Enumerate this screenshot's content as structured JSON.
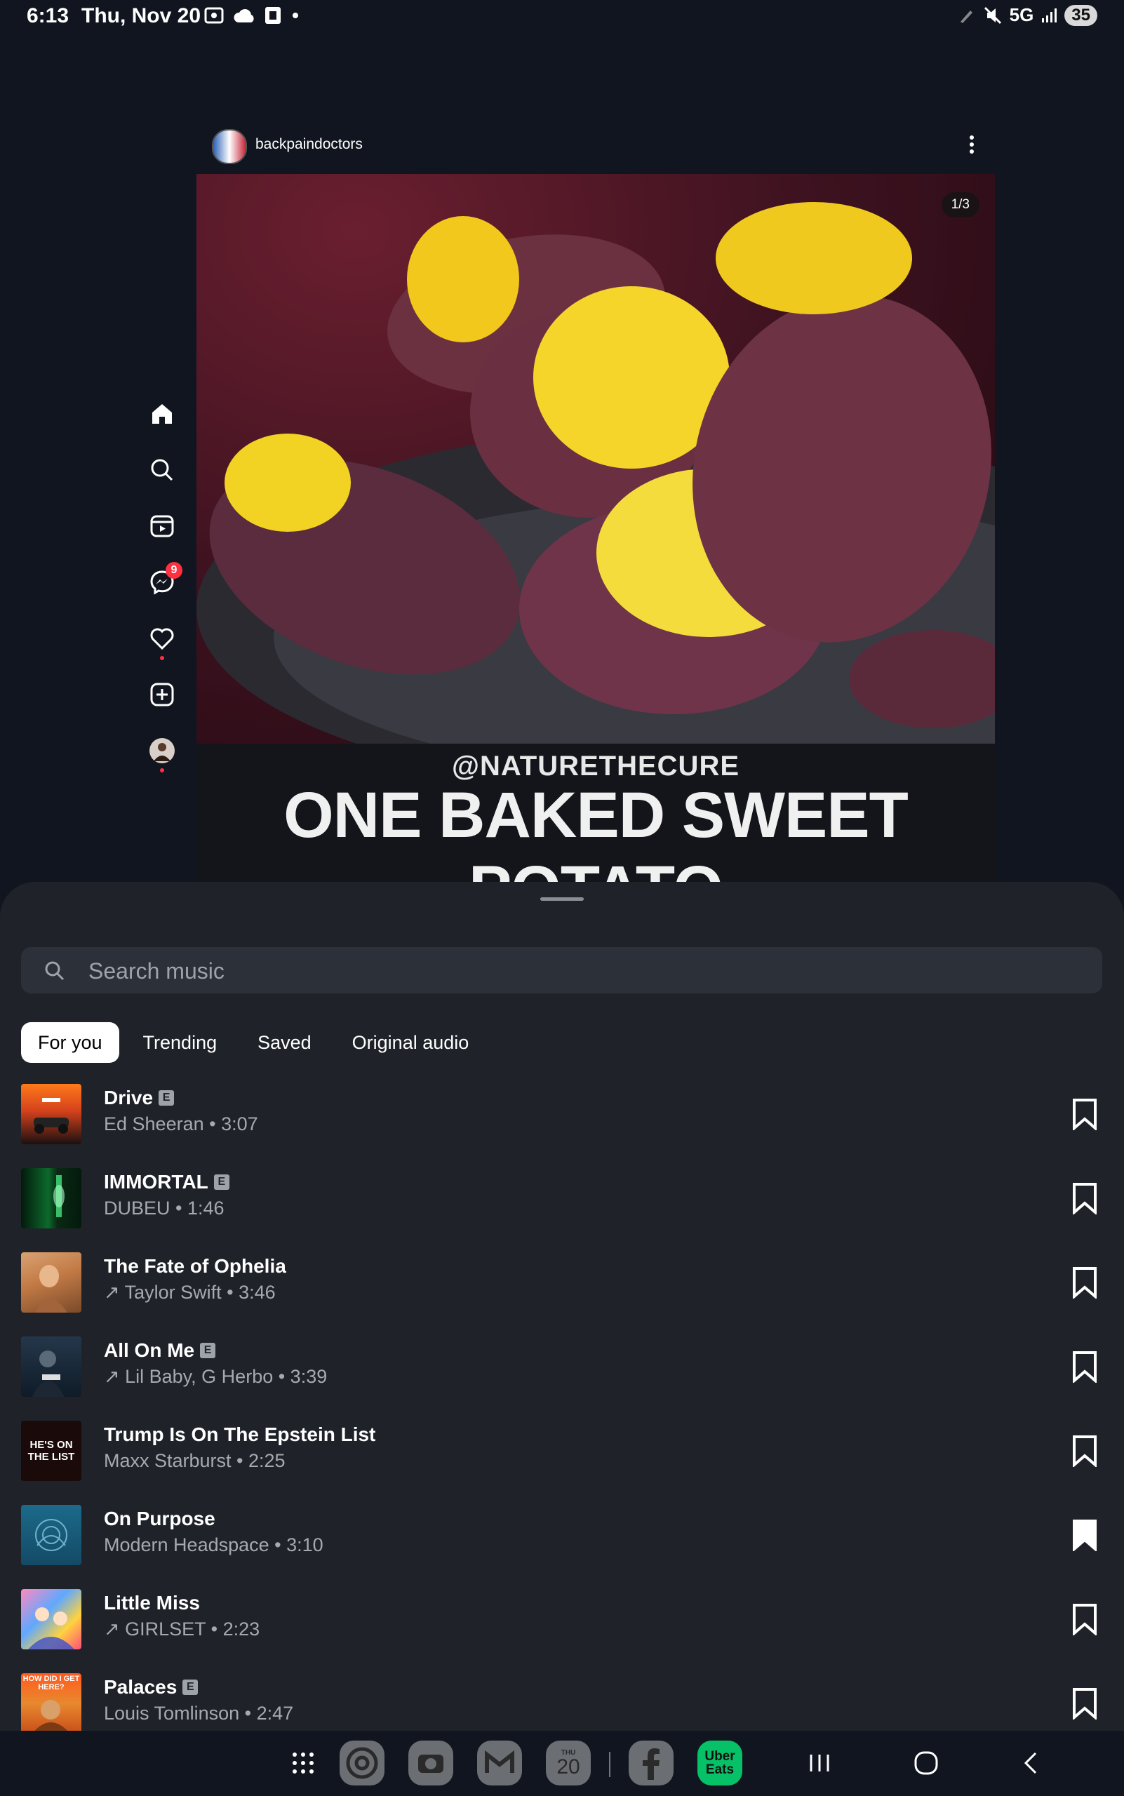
{
  "status_bar": {
    "time": "6:13",
    "date": "Thu, Nov 20",
    "network": "5G",
    "battery": "35"
  },
  "side_nav": {
    "items": [
      "home-icon",
      "search-icon",
      "reels-icon",
      "messenger-icon",
      "heart-icon",
      "create-icon",
      "profile-avatar"
    ],
    "messenger_badge": "9"
  },
  "post": {
    "username": "backpaindoctors",
    "counter": "1/3",
    "caption_handle": "@NATURETHECURE",
    "caption_title": "ONE BAKED SWEET POTATO"
  },
  "music_sheet": {
    "search_placeholder": "Search music",
    "tabs": [
      "For you",
      "Trending",
      "Saved",
      "Original audio"
    ],
    "active_tab": "For you",
    "tracks": [
      {
        "title": "Drive",
        "explicit": true,
        "meta": "Ed Sheeran • 3:07",
        "saved": false
      },
      {
        "title": "IMMORTAL",
        "explicit": true,
        "meta": "DUBEU • 1:46",
        "saved": false
      },
      {
        "title": "The Fate of Ophelia",
        "explicit": false,
        "meta": "↗ Taylor Swift • 3:46",
        "saved": false
      },
      {
        "title": "All On Me",
        "explicit": true,
        "meta": "↗ Lil Baby, G Herbo • 3:39",
        "saved": false
      },
      {
        "title": "Trump Is On The Epstein List",
        "explicit": false,
        "meta": "Maxx Starburst • 2:25",
        "saved": false
      },
      {
        "title": "On Purpose",
        "explicit": false,
        "meta": "Modern Headspace • 3:10",
        "saved": true
      },
      {
        "title": "Little Miss",
        "explicit": false,
        "meta": "↗ GIRLSET • 2:23",
        "saved": false
      },
      {
        "title": "Palaces",
        "explicit": true,
        "meta": "Louis Tomlinson • 2:47",
        "saved": false
      }
    ],
    "explicit_label": "E",
    "thumb_texts": {
      "epstein": "HE'S ON THE LIST",
      "palaces": "HOW DID I GET HERE?"
    }
  },
  "nav_bar": {
    "calendar_day": "20",
    "calendar_dow": "THU",
    "uber_eats": "Uber Eats"
  },
  "colors": {
    "background": "#10151f",
    "sheet": "#1f2329",
    "badge": "#ff3040",
    "uber_green": "#06c167"
  }
}
